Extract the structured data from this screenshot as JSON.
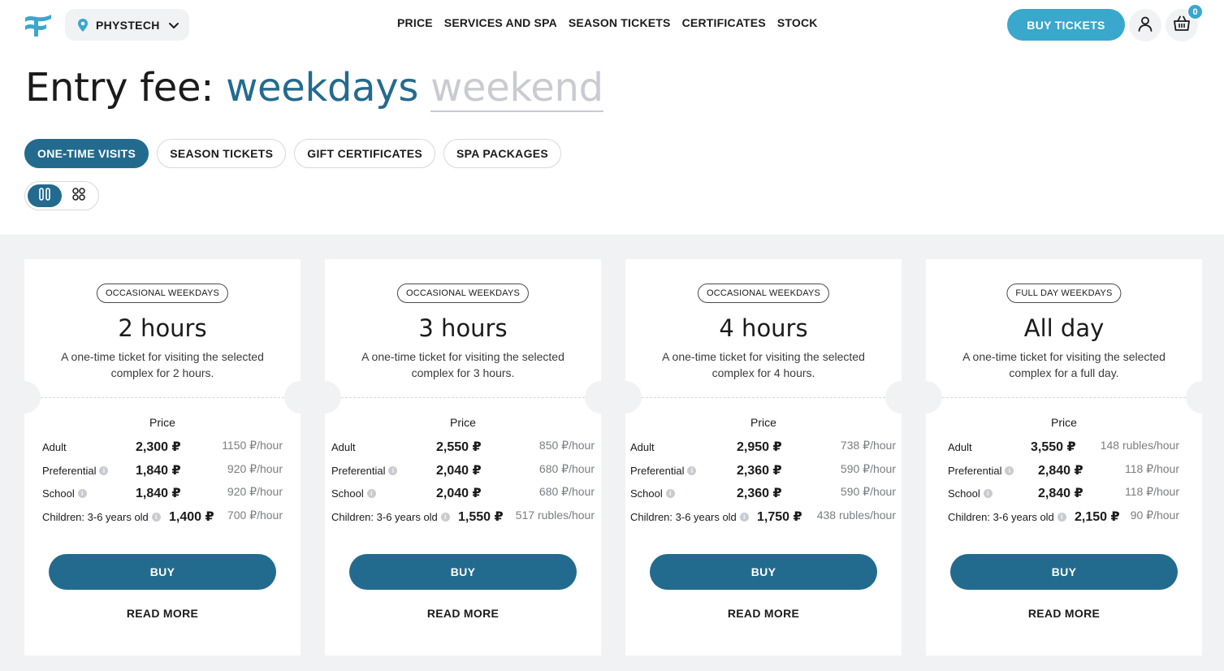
{
  "header": {
    "logo_icon": "brand-wave-logo",
    "location": "PHYSTECH",
    "nav": [
      "PRICE",
      "SERVICES AND SPA",
      "SEASON TICKETS",
      "CERTIFICATES",
      "STOCK"
    ],
    "buy_tickets": "BUY TICKETS",
    "cart_count": "0",
    "accent_color": "#3aa7cd"
  },
  "title": {
    "static": "Entry fee:",
    "active": "weekdays",
    "inactive": "weekend"
  },
  "tabs": [
    "ONE-TIME VISITS",
    "SEASON TICKETS",
    "GIFT CERTIFICATES",
    "SPA PACKAGES"
  ],
  "active_tab": "ONE-TIME VISITS",
  "primary_color": "#236b8e",
  "cards": [
    {
      "badge": "OCCASIONAL WEEKDAYS",
      "title": "2 hours",
      "description": "A one-time ticket for visiting the selected complex for 2 hours.",
      "price_label": "Price",
      "rows": [
        {
          "label": "Adult",
          "price": "2,300 ₽",
          "rate": "1150 ₽/hour"
        },
        {
          "label": "Preferential",
          "price": "1,840 ₽",
          "rate": "920 ₽/hour"
        },
        {
          "label": "School",
          "price": "1,840 ₽",
          "rate": "920 ₽/hour"
        },
        {
          "label": "Children: 3-6 years old",
          "price": "1,400 ₽",
          "rate": "700 ₽/hour"
        }
      ],
      "buy": "BUY",
      "more": "READ MORE"
    },
    {
      "badge": "OCCASIONAL WEEKDAYS",
      "title": "3 hours",
      "description": "A one-time ticket for visiting the selected complex for 3 hours.",
      "price_label": "Price",
      "rows": [
        {
          "label": "Adult",
          "price": "2,550 ₽",
          "rate": "850 ₽/hour"
        },
        {
          "label": "Preferential",
          "price": "2,040 ₽",
          "rate": "680 ₽/hour"
        },
        {
          "label": "School",
          "price": "2,040 ₽",
          "rate": "680 ₽/hour"
        },
        {
          "label": "Children: 3-6 years old",
          "price": "1,550 ₽",
          "rate": "517 rubles/hour"
        }
      ],
      "buy": "BUY",
      "more": "READ MORE"
    },
    {
      "badge": "OCCASIONAL WEEKDAYS",
      "title": "4 hours",
      "description": "A one-time ticket for visiting the selected complex for 4 hours.",
      "price_label": "Price",
      "rows": [
        {
          "label": "Adult",
          "price": "2,950 ₽",
          "rate": "738 ₽/hour"
        },
        {
          "label": "Preferential",
          "price": "2,360 ₽",
          "rate": "590 ₽/hour"
        },
        {
          "label": "School",
          "price": "2,360 ₽",
          "rate": "590 ₽/hour"
        },
        {
          "label": "Children: 3-6 years old",
          "price": "1,750 ₽",
          "rate": "438 rubles/hour"
        }
      ],
      "buy": "BUY",
      "more": "READ MORE"
    },
    {
      "badge": "FULL DAY WEEKDAYS",
      "title": "All day",
      "description": "A one-time ticket for visiting the selected complex for a full day.",
      "price_label": "Price",
      "rows": [
        {
          "label": "Adult",
          "price": "3,550 ₽",
          "rate": "148 rubles/hour"
        },
        {
          "label": "Preferential",
          "price": "2,840 ₽",
          "rate": "118 ₽/hour"
        },
        {
          "label": "School",
          "price": "2,840 ₽",
          "rate": "118 ₽/hour"
        },
        {
          "label": "Children: 3-6 years old",
          "price": "2,150 ₽",
          "rate": "90 ₽/hour"
        }
      ],
      "buy": "BUY",
      "more": "READ MORE"
    }
  ]
}
